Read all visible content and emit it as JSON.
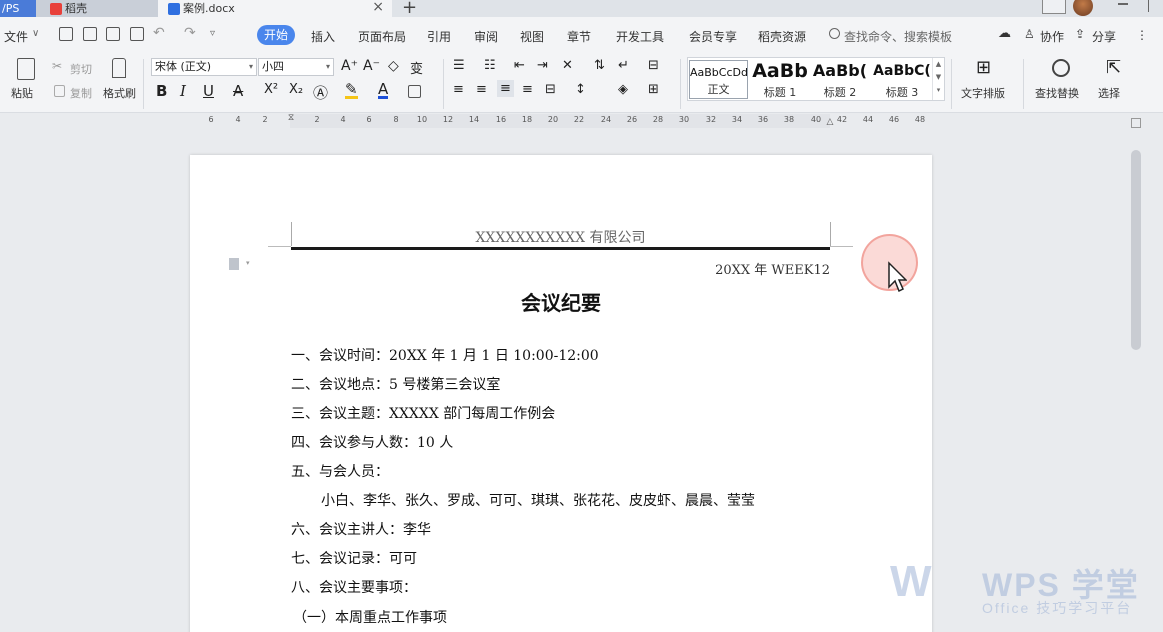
{
  "tabs": {
    "wps": "/PS",
    "daoke": "稻壳",
    "doc": "案例.docx",
    "close": "×",
    "add": "+"
  },
  "menu": {
    "file": "文件",
    "file_arrow": "∨",
    "start": "开始",
    "items": [
      "插入",
      "页面布局",
      "引用",
      "审阅",
      "视图",
      "章节",
      "开发工具",
      "会员专享",
      "稻壳资源"
    ],
    "search_placeholder": "查找命令、搜索模板",
    "collab": "协作",
    "share": "分享",
    "more": "⋮"
  },
  "ribbon": {
    "paste": "粘贴",
    "cut": "剪切",
    "copy": "复制",
    "format_painter": "格式刷",
    "font_name": "宋体 (正文)",
    "font_size": "小四",
    "grow_font": "A⁺",
    "shrink_font": "A⁻",
    "bold": "B",
    "italic": "I",
    "underline": "U",
    "superscript": "X²",
    "subscript": "X₂",
    "font_color": "A",
    "styles": [
      {
        "preview": "AaBbCcDd",
        "name": "正文"
      },
      {
        "preview": "AaBb",
        "name": "标题 1"
      },
      {
        "preview": "AaBb(",
        "name": "标题 2"
      },
      {
        "preview": "AaBbC(",
        "name": "标题 3"
      }
    ],
    "text_layout": "文字排版",
    "find_replace": "查找替换",
    "select": "选择"
  },
  "ruler": {
    "ticks": [
      "6",
      "4",
      "2",
      "2",
      "4",
      "6",
      "8",
      "10",
      "12",
      "14",
      "16",
      "18",
      "20",
      "22",
      "24",
      "26",
      "28",
      "30",
      "32",
      "34",
      "36",
      "38",
      "40",
      "42",
      "44",
      "46",
      "48"
    ]
  },
  "document": {
    "header_company": "XXXXXXXXXXX 有限公司",
    "header_date": "20XX 年 WEEK12",
    "title": "会议纪要",
    "lines": [
      "一、会议时间：20XX 年 1 月 1 日  10:00-12:00",
      "二、会议地点：5 号楼第三会议室",
      "三、会议主题：XXXXX 部门每周工作例会",
      "四、会议参与人数：10 人",
      "五、与会人员：",
      "小白、李华、张久、罗成、可可、琪琪、张花花、皮皮虾、晨晨、莹莹",
      "六、会议主讲人：李华",
      "七、会议记录：可可",
      "八、会议主要事项：",
      "（一）本周重点工作事项"
    ]
  },
  "watermark": {
    "logo": "W",
    "brand": "WPS 学堂",
    "tagline": "Office 技巧学习平台"
  }
}
